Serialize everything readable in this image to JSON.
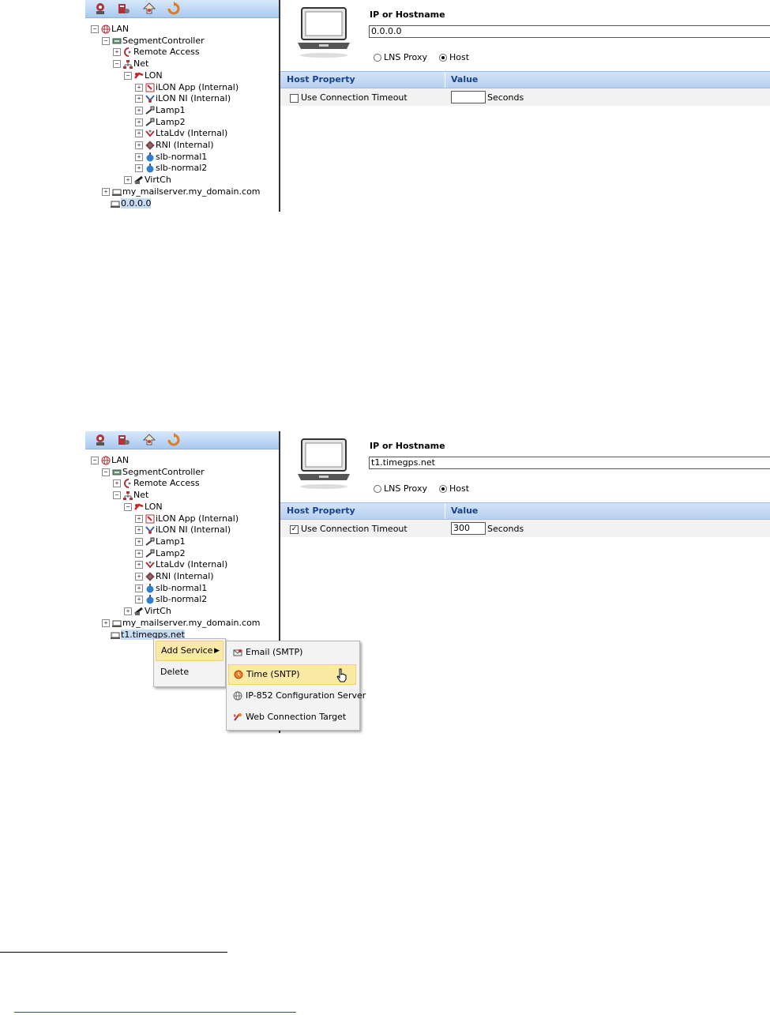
{
  "tree_items": [
    {
      "label": "LAN",
      "depth": 0,
      "exp": "-",
      "icon": "globe-icon"
    },
    {
      "label": "SegmentController",
      "depth": 1,
      "exp": "-",
      "icon": "controller-icon"
    },
    {
      "label": "Remote Access",
      "depth": 2,
      "exp": "+",
      "icon": "remote-access-icon"
    },
    {
      "label": "Net",
      "depth": 2,
      "exp": "-",
      "icon": "network-icon"
    },
    {
      "label": "LON",
      "depth": 3,
      "exp": "-",
      "icon": "lon-channel-icon"
    },
    {
      "label": "iLON App (Internal)",
      "depth": 4,
      "exp": "+",
      "icon": "app-device-icon"
    },
    {
      "label": "iLON NI (Internal)",
      "depth": 4,
      "exp": "+",
      "icon": "ni-device-icon"
    },
    {
      "label": "Lamp1",
      "depth": 4,
      "exp": "+",
      "icon": "lamp-device-icon"
    },
    {
      "label": "Lamp2",
      "depth": 4,
      "exp": "+",
      "icon": "lamp-device-icon"
    },
    {
      "label": "LtaLdv (Internal)",
      "depth": 4,
      "exp": "+",
      "icon": "ldv-device-icon"
    },
    {
      "label": "RNI (Internal)",
      "depth": 4,
      "exp": "+",
      "icon": "rni-device-icon"
    },
    {
      "label": "slb-normal1",
      "depth": 4,
      "exp": "+",
      "icon": "slb-device-icon"
    },
    {
      "label": "slb-normal2",
      "depth": 4,
      "exp": "+",
      "icon": "slb-device-icon"
    },
    {
      "label": "VirtCh",
      "depth": 3,
      "exp": "+",
      "icon": "virtual-channel-icon"
    },
    {
      "label": "my_mailserver.my_domain.com",
      "depth": 1,
      "exp": "+",
      "icon": "host-icon"
    }
  ],
  "shot1": {
    "selected_host": "0.0.0.0",
    "ip_label": "IP or Hostname",
    "ip_value": "0.0.0.0",
    "radio_lns": "LNS Proxy",
    "radio_host": "Host",
    "radio_selected": "host",
    "col_property": "Host Property",
    "col_value": "Value",
    "timeout_label": "Use Connection Timeout",
    "timeout_checked": false,
    "timeout_value": "",
    "seconds_label": "Seconds"
  },
  "shot2": {
    "selected_host": "t1.timegps.net",
    "ip_label": "IP or Hostname",
    "ip_value": "t1.timegps.net",
    "radio_lns": "LNS Proxy",
    "radio_host": "Host",
    "radio_selected": "host",
    "col_property": "Host Property",
    "col_value": "Value",
    "timeout_label": "Use Connection Timeout",
    "timeout_checked": true,
    "timeout_value": "300",
    "seconds_label": "Seconds",
    "context_menu": {
      "items": [
        "Add Service",
        "Delete"
      ],
      "highlighted": 0
    },
    "submenu": {
      "items": [
        {
          "label": "Email (SMTP)",
          "icon": "email-icon"
        },
        {
          "label": "Time (SNTP)",
          "icon": "clock-icon"
        },
        {
          "label": "IP-852 Configuration Server",
          "icon": "globe-icon"
        },
        {
          "label": "Web Connection Target",
          "icon": "web-target-icon"
        }
      ],
      "highlighted": 1
    }
  },
  "colors": {
    "header_text": "#15428b",
    "selection": "#c7dcf5",
    "menu_highlight": "#fbe9a6",
    "link_underline": "#2a3fd0"
  }
}
